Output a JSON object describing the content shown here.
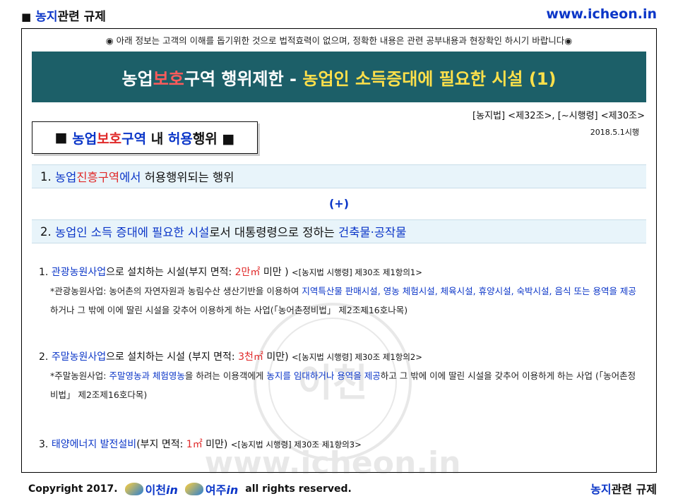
{
  "header": {
    "square": "■",
    "category_blue": "농지",
    "category_rest": "관련 규제",
    "site": "www.icheon.in"
  },
  "notice": "◉ 아래 정보는 고객의 이해를 돕기위한 것으로 법적효력이 없으며, 정확한 내용은 관련 공부내용과 현장확인 하시기 바랍니다◉",
  "title": {
    "part1": "농업",
    "part2": "보호",
    "part3": "구역 행위제한 - ",
    "part4": "농업인 소득증대에 필요한 시설 (1)"
  },
  "legal_ref": "[농지법] <제32조>, [~시행령] <제30조>",
  "effective_date": "2018.5.1시행",
  "box_title": {
    "lead": "■ ",
    "a": "농업",
    "b": "보호",
    "c": "구역",
    "d": " 내 ",
    "e": "허용",
    "f": "행위 ■"
  },
  "row1": {
    "num": "1. ",
    "a": "농업",
    "b": "진흥구역",
    "c": "에서 ",
    "d": "허용행위되는 행위"
  },
  "plus": "(+)",
  "row2": {
    "num": "2. ",
    "a": "농업인 소득 증대에 필요한 시설",
    "b": "로서 대통령령으로 정하는 ",
    "c": "건축물·공작물"
  },
  "items": [
    {
      "num": "1. ",
      "name": "관광농원사업",
      "text": "으로 설치하는 시설(부지 면적: ",
      "area": "2만㎡",
      "tail": " 미만 ) ",
      "ref": "<[농지법 시행령] 제30조 제1항의1>",
      "desc_a": "*관광농원사업: 농어촌의 자연자원과 농림수산 생산기반을 이용하여 ",
      "desc_b": "지역특산물 판매시설, 영농 체험시설, 체육시설, 휴양시설, 숙박시설, 음식 또는 용역을 제공",
      "desc_c": "하거나 그 밖에 이에 딸린 시설을 갖추어 이용하게 하는 사업(「농어촌정비법」 제2조제16호나목)"
    },
    {
      "num": "2. ",
      "name": "주말농원사업",
      "text": "으로 설치하는 시설 (부지 면적: ",
      "area": "3천㎡",
      "tail": " 미만) ",
      "ref": "<[농지법 시행령] 제30조 제1항의2>",
      "desc_a": "*주말농원사업: ",
      "desc_b": "주말영농과 체험영농",
      "desc_c": "을 하려는 이용객에게 ",
      "desc_d": "농지를 임대하거나 용역을 제공",
      "desc_e": "하고 그 밖에 이에 딸린 시설을 갖추어 이용하게 하는 사업 (「농어촌정비법」 제2조제16호다목)"
    },
    {
      "num": "3. ",
      "name": "태양에너지 발전설비",
      "text": "(부지 면적: ",
      "area": "1㎡",
      "tail": " 미만) ",
      "ref": "<[농지법 시행령] 제30조 제1항의3>"
    }
  ],
  "watermark": "www.icheon.in",
  "footer": {
    "copyright": "Copyright 2017.",
    "logo1": "이천",
    "logo1_in": "in",
    "logo2": "여주",
    "logo2_in": "in",
    "rights": "all rights reserved.",
    "right_blue": "농지",
    "right_rest": "관련 규제"
  },
  "colors": {
    "title_bg": "#1c5f68",
    "accent_blue": "#0b36c8",
    "accent_red": "#e02a2a",
    "band_bg": "#e8f4fa"
  }
}
